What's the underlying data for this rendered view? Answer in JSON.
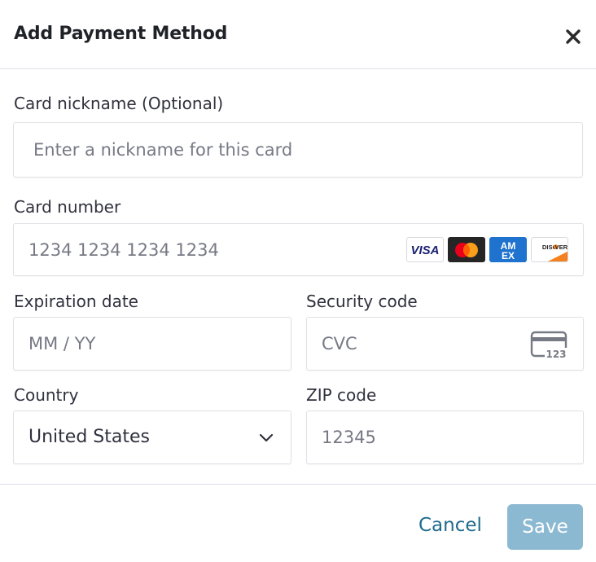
{
  "dialog": {
    "title": "Add Payment Method"
  },
  "form": {
    "nickname": {
      "label": "Card nickname (Optional)",
      "placeholder": "Enter a nickname for this card",
      "value": ""
    },
    "card_number": {
      "label": "Card number",
      "placeholder": "1234 1234 1234 1234",
      "value": ""
    },
    "brands": [
      {
        "name": "visa-icon",
        "text": "VISA",
        "color": "#1a1f71"
      },
      {
        "name": "mastercard-icon",
        "text": "",
        "color": "#252525"
      },
      {
        "name": "amex-icon",
        "text": "AMEX",
        "color": "#1f72cd"
      },
      {
        "name": "discover-icon",
        "text": "DISCOVER",
        "color": "#f58220"
      }
    ],
    "expiration": {
      "label": "Expiration date",
      "placeholder": "MM / YY",
      "value": ""
    },
    "security_code": {
      "label": "Security code",
      "placeholder": "CVC",
      "value": "",
      "icon_text": "123"
    },
    "country": {
      "label": "Country",
      "value": "United States"
    },
    "zip": {
      "label": "ZIP code",
      "placeholder": "12345",
      "value": ""
    }
  },
  "footer": {
    "cancel_label": "Cancel",
    "save_label": "Save"
  },
  "colors": {
    "primary_disabled": "#8cb9d2",
    "link": "#1f6b8f"
  }
}
